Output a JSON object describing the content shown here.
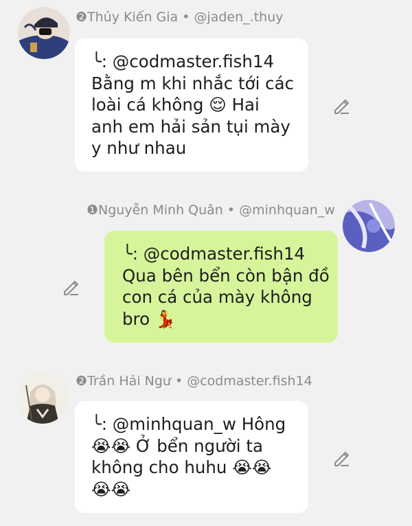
{
  "messages": [
    {
      "header": "❷Thủy Kiến Gia • @jaden_.thuy",
      "lines": [
        "╰: @codmaster.fish14",
        "Bằng m khi nhắc tới các",
        "loài cá không 😌 Hai",
        "anh em hải sản tụi mày",
        "y như nhau"
      ]
    },
    {
      "header": "❶Nguyễn Minh Quân • @minhquan_w",
      "lines": [
        "╰: @codmaster.fish14",
        "Qua bên bển còn bận đồ",
        "con cá của mày không",
        "bro 💃"
      ]
    },
    {
      "header": "❷Trần Hải Ngư • @codmaster.fish14",
      "lines": [
        "╰: @minhquan_w Hông",
        "😭😭 Ở bển người ta",
        "không cho huhu 😭😭",
        "😭😭"
      ]
    }
  ],
  "colors": {
    "background": "#f1f1f1",
    "bubble_left": "#ffffff",
    "bubble_right": "#d6f59b",
    "header_text": "#8a8a8a",
    "icon": "#8a8a8a"
  },
  "icons": [
    "pencil-edit-icon"
  ]
}
